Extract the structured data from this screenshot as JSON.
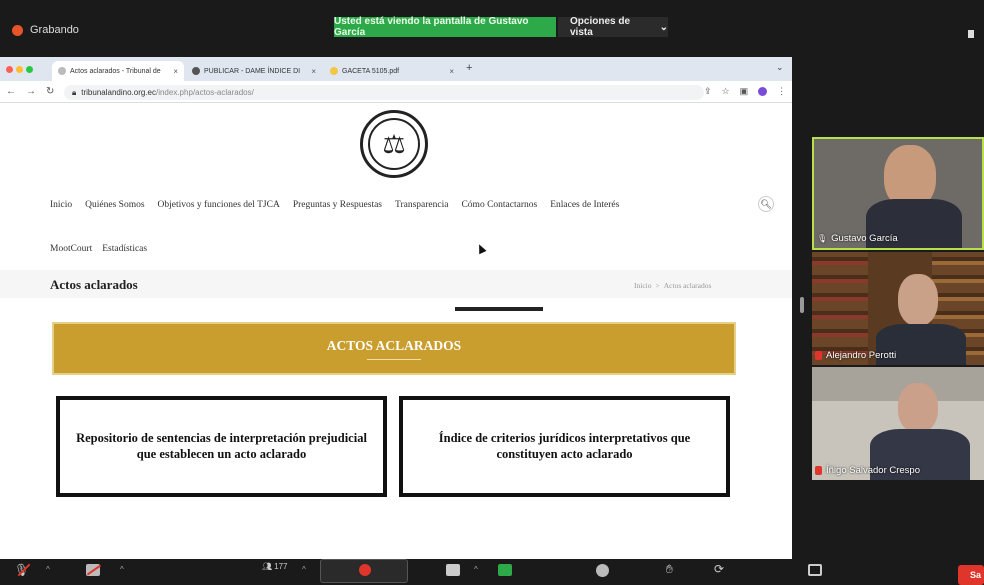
{
  "zoom": {
    "recording_label": "Grabando",
    "share_banner": "Usted está viendo la pantalla de Gustavo García",
    "view_options": "Opciones de vista",
    "participants_count": "177",
    "end_label": "Sa"
  },
  "browser": {
    "tabs": [
      {
        "title": "Actos aclarados - Tribunal de",
        "active": true
      },
      {
        "title": "PUBLICAR - DAME ÍNDICE DI",
        "active": false
      },
      {
        "title": "GACETA 5105.pdf",
        "active": false
      }
    ],
    "url_host": "tribunalandino.org.ec",
    "url_path": "/index.php/actos-aclarados/"
  },
  "site": {
    "nav": [
      "Inicio",
      "Quiénes Somos",
      "Objetivos y funciones del TJCA",
      "Preguntas y Respuestas",
      "Transparencia",
      "Cómo Contactarnos",
      "Enlaces de Interés"
    ],
    "subnav": [
      "MootCourt",
      "Estadísticas"
    ],
    "page_title": "Actos aclarados",
    "breadcrumb": {
      "home": "Inicio",
      "sep": ">",
      "current": "Actos aclarados"
    },
    "banner": "ACTOS ACLARADOS",
    "cards": [
      "Repositorio de sentencias de interpretación prejudicial que establecen un acto aclarado",
      "Índice de criterios jurídicos interpretativos que constituyen acto aclarado"
    ]
  },
  "participants": [
    {
      "name": "Gustavo García",
      "muted": false,
      "active_speaker": true
    },
    {
      "name": "Alejandro Perotti",
      "muted": true,
      "active_speaker": false
    },
    {
      "name": "Íñigo Salvador Crespo",
      "muted": true,
      "active_speaker": false
    }
  ],
  "colors": {
    "share_green": "#2ea94a",
    "banner_gold": "#c99d2e",
    "record_red": "#e8542a",
    "speaker_border": "#b7e04a"
  },
  "icons": [
    "search-icon",
    "scales-of-justice-icon",
    "microphone-muted-icon",
    "video-off-icon",
    "participants-icon",
    "chat-icon",
    "share-screen-icon",
    "record-icon",
    "reactions-icon",
    "apps-icon",
    "whiteboard-icon"
  ]
}
